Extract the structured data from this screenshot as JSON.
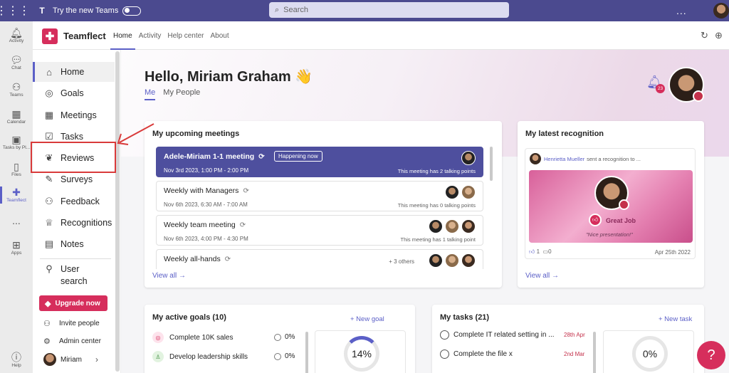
{
  "topbar": {
    "try_new": "Try the new Teams",
    "search_placeholder": "Search",
    "more": "..."
  },
  "rail": [
    {
      "label": "Activity",
      "icon": "bell-icon"
    },
    {
      "label": "Chat",
      "icon": "chat-icon"
    },
    {
      "label": "Teams",
      "icon": "teams-icon"
    },
    {
      "label": "Calendar",
      "icon": "calendar-icon"
    },
    {
      "label": "Tasks by Pl...",
      "icon": "tasks-icon"
    },
    {
      "label": "Files",
      "icon": "file-icon"
    },
    {
      "label": "Teamflect",
      "icon": "teamflect-icon"
    },
    {
      "label": "...",
      "icon": "more-icon"
    },
    {
      "label": "Apps",
      "icon": "apps-icon"
    },
    {
      "label": "Help",
      "icon": "help-icon"
    }
  ],
  "app": {
    "name": "Teamflect",
    "nav": [
      "Home",
      "Activity",
      "Help center",
      "About"
    ]
  },
  "sidebar": {
    "items": [
      "Home",
      "Goals",
      "Meetings",
      "Tasks",
      "Reviews",
      "Surveys",
      "Feedback",
      "Recognitions",
      "Notes"
    ],
    "user_search_1": "User",
    "user_search_2": "search",
    "upgrade": "Upgrade now",
    "invite": "Invite people",
    "admin": "Admin center",
    "user": "Miriam"
  },
  "greeting": {
    "title": "Hello, Miriam Graham",
    "wave": "👋",
    "tabs": [
      "Me",
      "My People"
    ],
    "notif_count": "23"
  },
  "meetings": {
    "title": "My upcoming meetings",
    "happening": "Happening now",
    "view_all": "View all  →",
    "items": [
      {
        "title": "Adele-Miriam 1-1 meeting",
        "time": "Nov 3rd 2023, 1:00 PM - 2:00 PM",
        "points": "This meeting has 2 talking points"
      },
      {
        "title": "Weekly with Managers",
        "time": "Nov 6th 2023, 6:30 AM - 7:00 AM",
        "points": "This meeting has 0 talking points"
      },
      {
        "title": "Weekly team meeting",
        "time": "Nov 6th 2023, 4:00 PM - 4:30 PM",
        "points": "This meeting has 1 talking point"
      },
      {
        "title": "Weekly all-hands",
        "others": "+ 3 others"
      }
    ]
  },
  "recognition": {
    "title": "My latest recognition",
    "sender": "Henrietta Mueller",
    "sent_text": "sent a recognition to ...",
    "badge": "Great Job",
    "quote": "\"Nice presentation!\"",
    "likes": "1",
    "comments": "0",
    "date": "Apr 25th 2022",
    "view_all": "View all  →"
  },
  "goals": {
    "title": "My active goals (10)",
    "new": "+ New goal",
    "items": [
      {
        "label": "Complete 10K sales",
        "pct": "0%"
      },
      {
        "label": "Develop leadership skills",
        "pct": "0%"
      }
    ],
    "progress": "14%",
    "progress_value": 0.14
  },
  "tasks": {
    "title": "My tasks (21)",
    "new": "+ New task",
    "items": [
      {
        "label": "Complete IT related setting in ...",
        "date": "28th Apr"
      },
      {
        "label": "Complete the file x",
        "date": "2nd Mar"
      }
    ],
    "progress": "0%",
    "progress_value": 0
  },
  "help": "?"
}
